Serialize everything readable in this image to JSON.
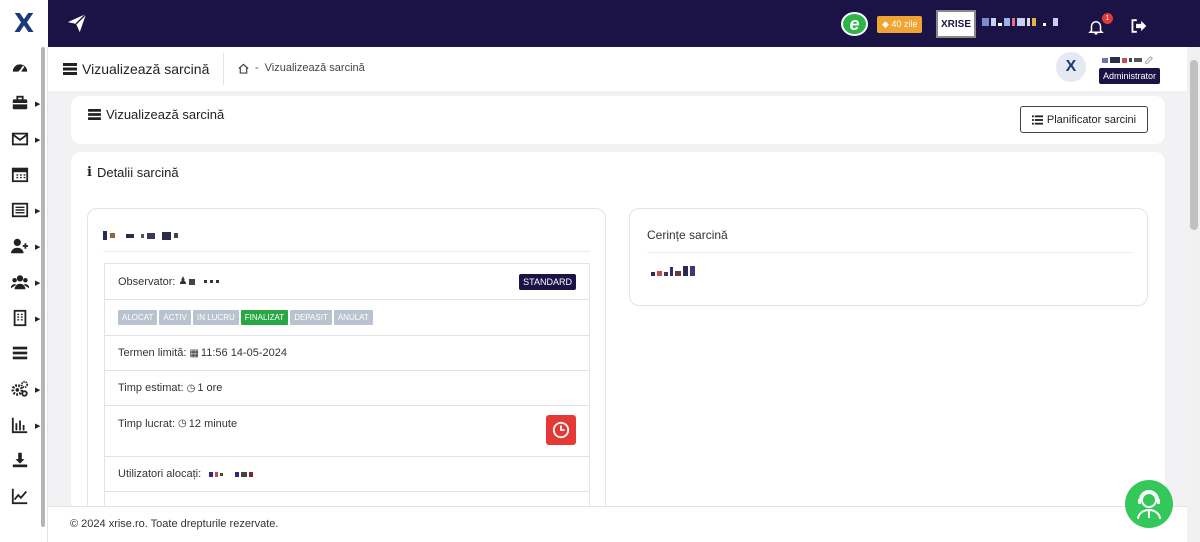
{
  "topbar": {
    "logo": "X",
    "trial_badge": "40 zile",
    "e_badge": "e",
    "company_logo": "XRISE",
    "notification_count": "1"
  },
  "sidebar": {
    "items": [
      {
        "icon": "dashboard-icon",
        "has_submenu": false
      },
      {
        "icon": "briefcase-icon",
        "has_submenu": true
      },
      {
        "icon": "envelope-icon",
        "has_submenu": true
      },
      {
        "icon": "calendar-icon",
        "has_submenu": false
      },
      {
        "icon": "list-icon",
        "has_submenu": true
      },
      {
        "icon": "user-plus-icon",
        "has_submenu": true
      },
      {
        "icon": "users-icon",
        "has_submenu": true
      },
      {
        "icon": "building-icon",
        "has_submenu": true
      },
      {
        "icon": "tasks-icon",
        "has_submenu": false
      },
      {
        "icon": "cogs-icon",
        "has_submenu": true
      },
      {
        "icon": "bar-chart-icon",
        "has_submenu": true
      },
      {
        "icon": "download-icon",
        "has_submenu": false
      },
      {
        "icon": "line-chart-icon",
        "has_submenu": false
      }
    ]
  },
  "page_header": {
    "title": "Vizualizează sarcină",
    "breadcrumb_sep": "-",
    "breadcrumb_current": "Vizualizează sarcină"
  },
  "user": {
    "avatar": "X",
    "role": "Administrator"
  },
  "card_view": {
    "title": "Vizualizează sarcină",
    "planner_button": "Planificator sarcini"
  },
  "card_details": {
    "title": "Detalii sarcină"
  },
  "task": {
    "observer_label": "Observator:",
    "type_badge": "STANDARD",
    "statuses": [
      {
        "label": "ALOCAT",
        "active": false
      },
      {
        "label": "ACTIV",
        "active": false
      },
      {
        "label": "IN LUCRU",
        "active": false
      },
      {
        "label": "FINALIZAT",
        "active": true
      },
      {
        "label": "DEPASIT",
        "active": false
      },
      {
        "label": "ANULAT",
        "active": false
      }
    ],
    "deadline_label": "Termen limită:",
    "deadline_value": "11:56 14-05-2024",
    "estimated_label": "Timp estimat:",
    "estimated_value": "1 ore",
    "worked_label": "Timp lucrat:",
    "worked_value": "12 minute",
    "assigned_label": "Utilizatori alocați:"
  },
  "requirements": {
    "title": "Cerințe sarcină"
  },
  "footer": {
    "text": "© 2024 xrise.ro. Toate drepturile rezervate."
  },
  "colors": {
    "navy": "#1b1346",
    "finalizat": "#28a745",
    "status_inactive": "#b9c3cf",
    "timer": "#e53935",
    "chat": "#34c759"
  }
}
